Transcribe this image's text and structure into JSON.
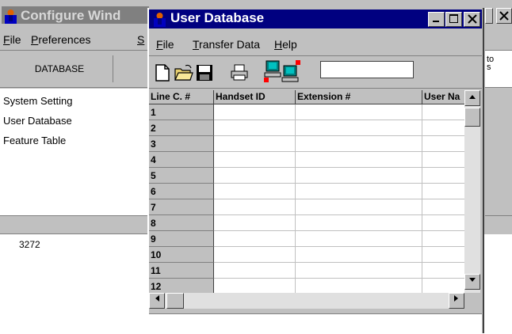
{
  "background_window": {
    "title": "Configure Wind",
    "menu": [
      {
        "label": "File",
        "accel": "F"
      },
      {
        "label": "Preferences",
        "accel": "P"
      },
      {
        "label": "S",
        "accel": "S"
      }
    ],
    "toolbar_button": "DATABASE",
    "nav_items": [
      "System Setting",
      "User Database",
      "Feature Table"
    ],
    "right_text_line1": "to",
    "right_text_line2": "s"
  },
  "caption_number": "3272",
  "user_database_window": {
    "title": "User Database",
    "menu": [
      {
        "label": "File",
        "accel": "F"
      },
      {
        "label": "Transfer Data",
        "accel": "T"
      },
      {
        "label": "Help",
        "accel": "H"
      }
    ],
    "toolbar_icons": [
      "new-file-icon",
      "open-folder-icon",
      "save-icon",
      "print-icon",
      "transfer-computers-icon"
    ],
    "search_value": "",
    "grid": {
      "columns": [
        "Line C. #",
        "Handset ID",
        "Extension #",
        "User Na"
      ],
      "rows": [
        "1",
        "2",
        "3",
        "4",
        "5",
        "6",
        "7",
        "8",
        "9",
        "10",
        "11",
        "12"
      ]
    }
  },
  "colors": {
    "active_title": "#000080",
    "inactive_title": "#808080",
    "chrome": "#c0c0c0"
  }
}
